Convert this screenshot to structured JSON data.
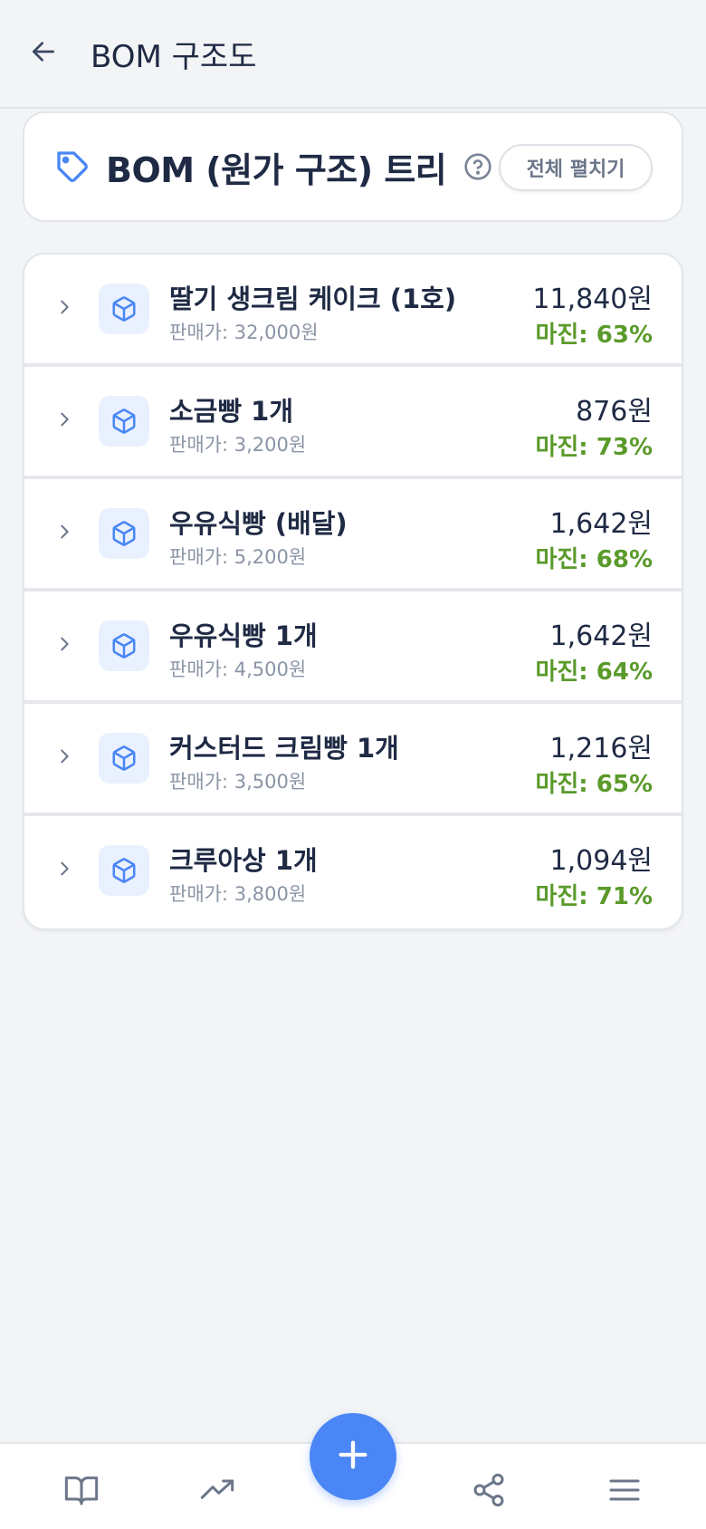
{
  "header": {
    "title": "BOM 구조도"
  },
  "tree": {
    "title": "BOM (원가 구조) 트리",
    "expand_all_label": "전체 펼치기"
  },
  "products": [
    {
      "name": "딸기 생크림 케이크 (1호)",
      "price": "판매가: 32,000원",
      "cost": "11,840원",
      "margin": "마진: 63%"
    },
    {
      "name": "소금빵 1개",
      "price": "판매가: 3,200원",
      "cost": "876원",
      "margin": "마진: 73%"
    },
    {
      "name": "우유식빵 (배달)",
      "price": "판매가: 5,200원",
      "cost": "1,642원",
      "margin": "마진: 68%"
    },
    {
      "name": "우유식빵 1개",
      "price": "판매가: 4,500원",
      "cost": "1,642원",
      "margin": "마진: 64%"
    },
    {
      "name": "커스터드 크림빵 1개",
      "price": "판매가: 3,500원",
      "cost": "1,216원",
      "margin": "마진: 65%"
    },
    {
      "name": "크루아상 1개",
      "price": "판매가: 3,800원",
      "cost": "1,094원",
      "margin": "마진: 71%"
    }
  ],
  "nav": {
    "items": [
      "book-icon",
      "trending-up-icon",
      "plus-icon",
      "share-icon",
      "menu-icon"
    ]
  },
  "colors": {
    "accent": "#4a86f5",
    "margin_green": "#5a9a2a",
    "text_dark": "#1f2a44"
  }
}
